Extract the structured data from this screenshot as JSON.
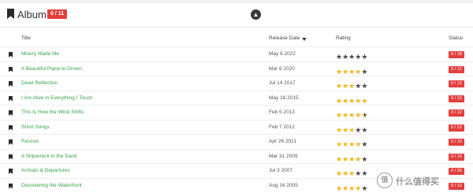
{
  "header": {
    "title": "Album",
    "count_badge": "0 / 11",
    "collapse_icon": "chevron-up-icon"
  },
  "columns": {
    "title": "Title",
    "release_date": "Release Date",
    "rating": "Rating",
    "status": "Status"
  },
  "colors": {
    "accent_green": "#3aa24a",
    "badge_red": "#e2403d",
    "star_gold": "#f2b51b",
    "star_dark": "#4a4a4a"
  },
  "albums": [
    {
      "title": "Misery Made Me",
      "date": "May 6 2022",
      "rating": 0,
      "status": "0 / 18"
    },
    {
      "title": "A Beautiful Place to Drown",
      "date": "Mar 6 2020",
      "rating": 4,
      "status": "0 / 12"
    },
    {
      "title": "Dead Reflection",
      "date": "Jul 14 2017",
      "rating": 3,
      "status": "0 / 12"
    },
    {
      "title": "I Am Alive in Everything I Touch",
      "date": "May 18 2015",
      "rating": 5,
      "status": "0 / 12"
    },
    {
      "title": "This Is How the Wind Shifts",
      "date": "Feb 5 2013",
      "rating": 4.5,
      "status": "0 / 12"
    },
    {
      "title": "Short Songs",
      "date": "Feb 7 2012",
      "rating": 3,
      "status": "0 / 22"
    },
    {
      "title": "Rescue",
      "date": "Apr 26 2011",
      "rating": 4,
      "status": "0 / 19"
    },
    {
      "title": "A Shipwreck in the Sand",
      "date": "Mar 31 2009",
      "rating": 4,
      "status": "0 / 19"
    },
    {
      "title": "Arrivals & Departures",
      "date": "Jul 3 2007",
      "rating": 3,
      "status": "0 / 26"
    },
    {
      "title": "Discovering the Waterfront",
      "date": "Aug 16 2005",
      "rating": 4,
      "status": "0 / 12"
    }
  ],
  "watermark": {
    "logo_text": "值",
    "text": "什么值得买"
  }
}
